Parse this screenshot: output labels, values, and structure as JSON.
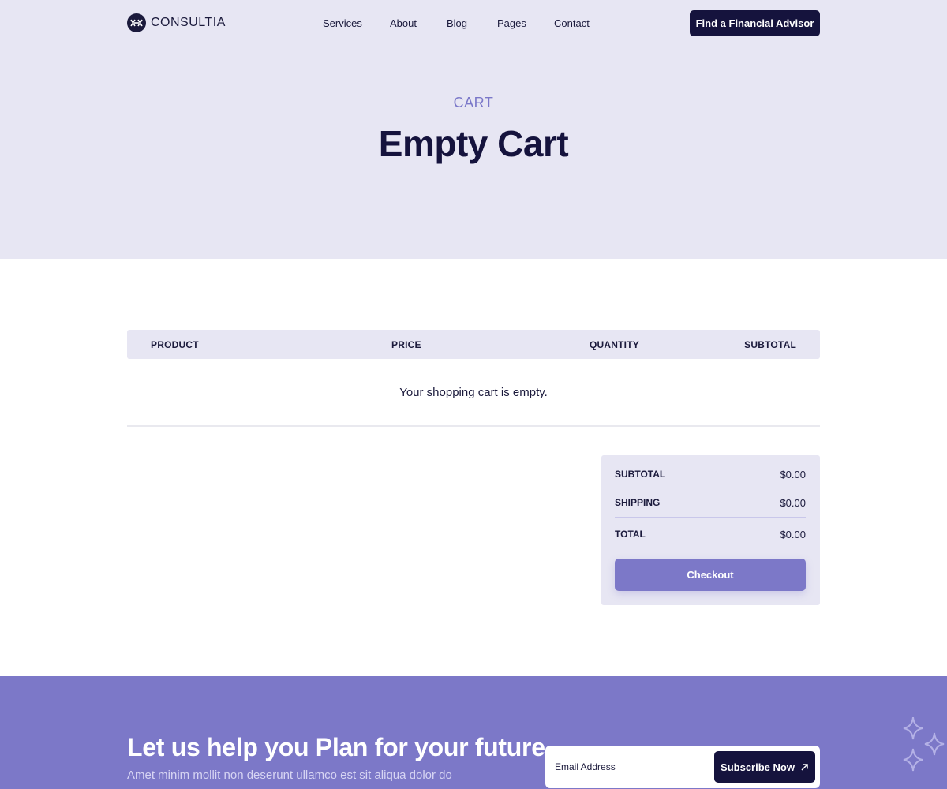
{
  "brand": {
    "name": "CONSULTIA"
  },
  "nav": {
    "items": [
      {
        "label": "Services"
      },
      {
        "label": "About"
      },
      {
        "label": "Blog"
      },
      {
        "label": "Pages"
      },
      {
        "label": "Contact"
      }
    ],
    "cta_label": "Find a Financial Advisor"
  },
  "hero": {
    "eyebrow": "CART",
    "title": "Empty Cart"
  },
  "cart": {
    "columns": [
      "PRODUCT",
      "PRICE",
      "QUANTITY",
      "SUBTOTAL"
    ],
    "empty_message": "Your shopping cart is empty."
  },
  "totals": {
    "rows": [
      {
        "label": "SUBTOTAL",
        "value": "$0.00"
      },
      {
        "label": "SHIPPING",
        "value": "$0.00"
      },
      {
        "label": "TOTAL",
        "value": "$0.00"
      }
    ],
    "checkout_label": "Checkout"
  },
  "newsletter": {
    "title": "Let us help you Plan for your future.",
    "subtitle": "Amet minim mollit non deserunt ullamco est sit aliqua dolor do",
    "email_placeholder": "Email Address",
    "button_label": "Subscribe Now",
    "button_icon": "arrow-up-right-icon"
  },
  "colors": {
    "hero_bg": "#e7e6f3",
    "navy": "#15133d",
    "accent": "#7c78c8",
    "eyebrow": "#7b78c9"
  }
}
